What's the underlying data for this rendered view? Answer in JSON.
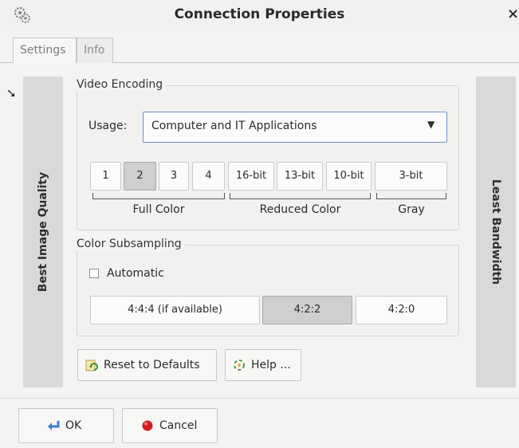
{
  "window": {
    "title": "Connection Properties",
    "close_glyph": "×"
  },
  "tabs": [
    {
      "label": "Settings",
      "active": true
    },
    {
      "label": "Info",
      "active": false
    }
  ],
  "sidebars": {
    "left_label": "Best Image Quality",
    "right_label": "Least Bandwidth"
  },
  "video_encoding": {
    "legend": "Video Encoding",
    "usage_label": "Usage:",
    "usage_value": "Computer and IT Applications",
    "quality_options": [
      {
        "label": "1",
        "selected": false
      },
      {
        "label": "2",
        "selected": true
      },
      {
        "label": "3",
        "selected": false
      },
      {
        "label": "4",
        "selected": false
      },
      {
        "label": "16-bit",
        "selected": false
      },
      {
        "label": "13-bit",
        "selected": false
      },
      {
        "label": "10-bit",
        "selected": false
      },
      {
        "label": "3-bit",
        "selected": false
      }
    ],
    "groups": [
      "Full Color",
      "Reduced Color",
      "Gray"
    ]
  },
  "color_subsampling": {
    "legend": "Color Subsampling",
    "automatic_label": "Automatic",
    "automatic_checked": false,
    "options": [
      {
        "label": "4:4:4 (if available)",
        "selected": false
      },
      {
        "label": "4:2:2",
        "selected": true
      },
      {
        "label": "4:2:0",
        "selected": false
      }
    ]
  },
  "buttons": {
    "reset": "Reset to Defaults",
    "help": "Help ...",
    "ok": "OK",
    "cancel": "Cancel"
  },
  "colors": {
    "accent_border": "#6f8fc6",
    "selected_bg": "#cfcfcd",
    "cancel_red": "#d11f1f",
    "ok_blue": "#3f7fd6"
  },
  "icons": [
    "app-gears-icon",
    "dropdown-arrow-icon",
    "reset-icon",
    "help-icon",
    "ok-arrow-icon",
    "cancel-icon",
    "mouse-cursor-icon"
  ]
}
